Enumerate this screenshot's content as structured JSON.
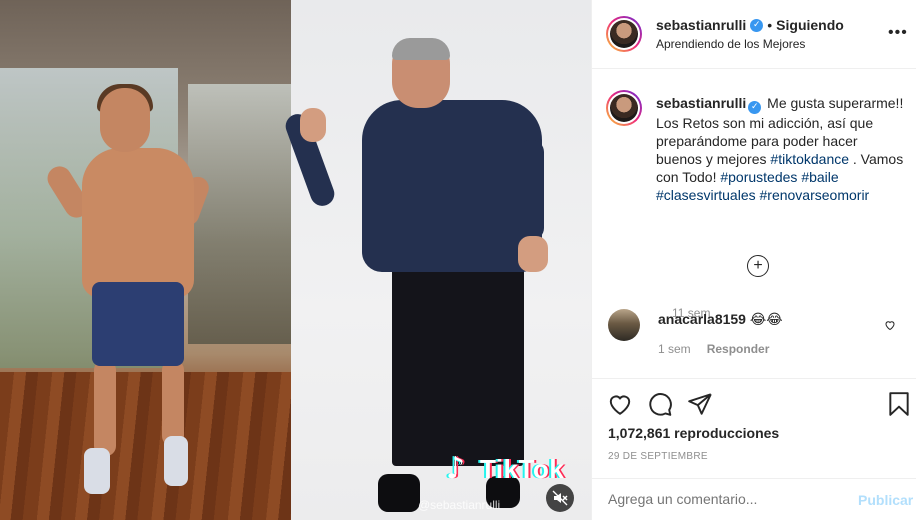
{
  "header": {
    "username": "sebastianrulli",
    "separator": "•",
    "follow_status": "Siguiendo",
    "location": "Aprendiendo de los Mejores"
  },
  "video": {
    "watermark": "TikTok",
    "watermark_user": "@sebastianrulli"
  },
  "caption": {
    "username": "sebastianrulli",
    "text_1": "Me gusta superarme!! Los Retos son mi adicción, así que preparándome para poder hacer buenos y mejores",
    "hashtag_1": "#tiktokdance",
    "text_2": ". Vamos con Todo!",
    "hashtag_2": "#porustedes",
    "hashtag_3": "#baile",
    "hashtag_4": "#clasesvirtuales",
    "hashtag_5": "#renovarseomorir",
    "time": "11 sem"
  },
  "load_more": "+",
  "comment": {
    "username": "anacarla8159",
    "text": "😂😂",
    "time": "1 sem",
    "reply": "Responder"
  },
  "stats": {
    "views": "1,072,861 reproducciones",
    "date": "29 DE SEPTIEMBRE"
  },
  "comment_box": {
    "placeholder": "Agrega un comentario...",
    "publish": "Publicar"
  },
  "colors": {
    "link": "#00376b",
    "verified": "#3897f0",
    "publish_disabled": "#b2dffc",
    "muted_text": "#8e8e8e"
  }
}
